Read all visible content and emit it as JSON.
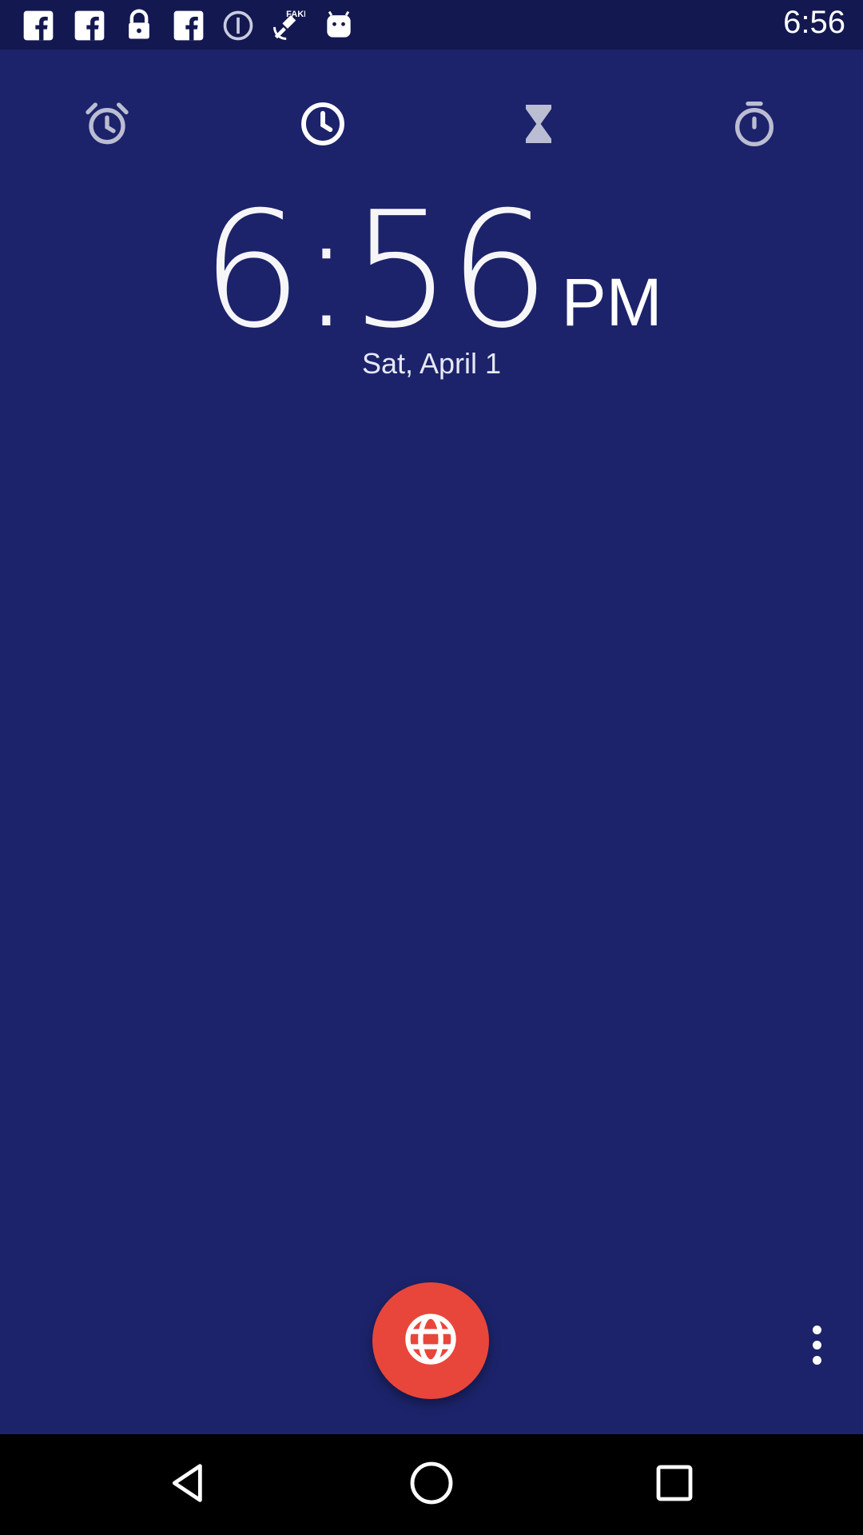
{
  "status_bar": {
    "time": "6:56",
    "icons": [
      "facebook-icon",
      "facebook-icon",
      "lock-icon",
      "facebook-icon",
      "info-icon",
      "fake-gps-icon",
      "android-icon"
    ]
  },
  "tabs": [
    {
      "name": "alarm",
      "icon": "alarm-icon",
      "selected": false
    },
    {
      "name": "clock",
      "icon": "clock-icon",
      "selected": true
    },
    {
      "name": "timer",
      "icon": "hourglass-icon",
      "selected": false
    },
    {
      "name": "stopwatch",
      "icon": "stopwatch-icon",
      "selected": false
    }
  ],
  "clock": {
    "time": "6:56",
    "ampm": "PM",
    "date": "Sat, April 1"
  },
  "fab": {
    "icon": "globe-icon",
    "color": "#e8463a"
  },
  "menu": {
    "icon": "more-vert-icon"
  },
  "nav": [
    "back-icon",
    "home-icon",
    "recents-icon"
  ],
  "colors": {
    "background": "#1c236a",
    "status_bar": "#141850",
    "accent": "#e8463a"
  }
}
